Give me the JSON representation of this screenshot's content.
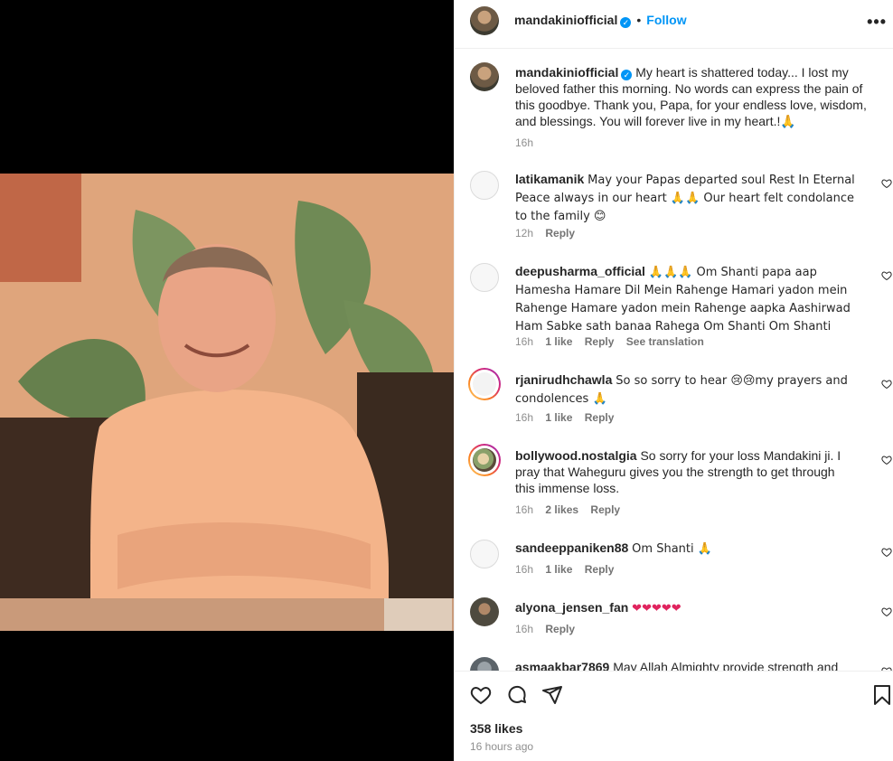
{
  "post": {
    "username": "mandakiniofficial",
    "follow_label": "Follow",
    "more_label": "•••",
    "caption": "My heart is shattered today... I lost my beloved father this morning. No words can express the pain of this goodbye. Thank you, Papa, for your endless love, wisdom, and blessings. You will forever live in my heart.!🙏",
    "caption_time": "16h"
  },
  "comments": [
    {
      "user": "latikamanik",
      "text": "May your Papas departed soul Rest In Eternal Peace always in our heart 🙏🙏 Our heart felt condolance to the family 😊",
      "time": "12h",
      "likes": "",
      "reply": "Reply",
      "translate": ""
    },
    {
      "user": "deepusharma_official",
      "text": "🙏🙏🙏 Om Shanti papa aap Hamesha Hamare Dil Mein Rahenge Hamari yadon mein Rahenge Hamare yadon mein Rahenge aapka Aashirwad Ham Sabke sath banaa Rahega Om Shanti Om Shanti",
      "time": "16h",
      "likes": "1 like",
      "reply": "Reply",
      "translate": "See translation"
    },
    {
      "user": "rjanirudhchawla",
      "text": "So so sorry to hear 😢😢my prayers and condolences 🙏",
      "time": "16h",
      "likes": "1 like",
      "reply": "Reply",
      "translate": ""
    },
    {
      "user": "bollywood.nostalgia",
      "text": "So sorry for your loss Mandakini ji. I pray that Waheguru gives you the strength to get through this immense loss.",
      "time": "16h",
      "likes": "2 likes",
      "reply": "Reply",
      "translate": ""
    },
    {
      "user": "sandeeppaniken88",
      "text": "Om Shanti 🙏",
      "time": "16h",
      "likes": "1 like",
      "reply": "Reply",
      "translate": ""
    },
    {
      "user": "alyona_jensen_fan",
      "text": "❤❤❤❤❤",
      "time": "16h",
      "likes": "",
      "reply": "Reply",
      "translate": ""
    },
    {
      "user": "asmaakbar7869",
      "text": "May Allah Almighty provide strength and",
      "time": "",
      "likes": "",
      "reply": "",
      "translate": ""
    }
  ],
  "footer": {
    "likes": "358 likes",
    "posted": "16 hours ago"
  },
  "icons": [
    "heart-icon",
    "comment-icon",
    "share-icon",
    "bookmark-icon",
    "verified-icon",
    "more-icon"
  ],
  "colors": {
    "accent": "#0095f6",
    "text": "#262626",
    "muted": "#8e8e8e"
  }
}
